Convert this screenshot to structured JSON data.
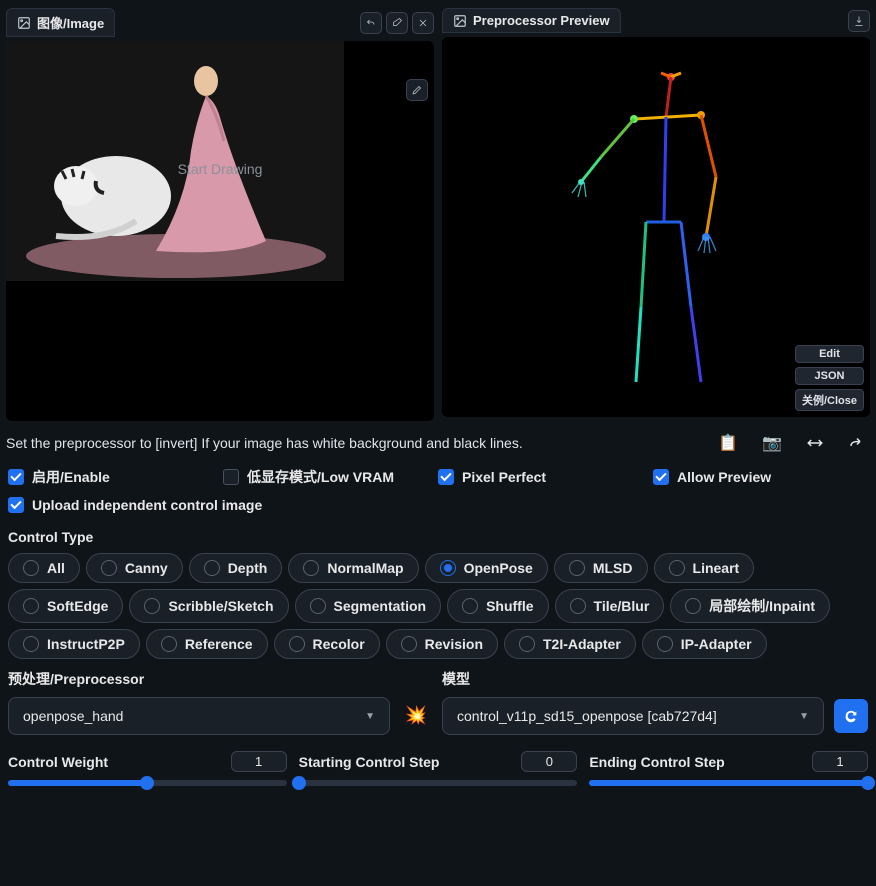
{
  "image_tab": "图像/Image",
  "preview_tab": "Preprocessor Preview",
  "draw_hint": "Start Drawing",
  "side_edit": "Edit",
  "side_json": "JSON",
  "side_close": "关例/Close",
  "hint": "Set the preprocessor to [invert] If your image has white background and black lines.",
  "cb_enable": "启用/Enable",
  "cb_lowvram": "低显存模式/Low VRAM",
  "cb_pixel": "Pixel Perfect",
  "cb_allow": "Allow Preview",
  "cb_upload": "Upload independent control image",
  "control_type_label": "Control Type",
  "types": [
    "All",
    "Canny",
    "Depth",
    "NormalMap",
    "OpenPose",
    "MLSD",
    "Lineart",
    "SoftEdge",
    "Scribble/Sketch",
    "Segmentation",
    "Shuffle",
    "Tile/Blur",
    "局部绘制/Inpaint",
    "InstructP2P",
    "Reference",
    "Recolor",
    "Revision",
    "T2I-Adapter",
    "IP-Adapter"
  ],
  "selected_type": "OpenPose",
  "preproc_label": "预处理/Preprocessor",
  "preproc_value": "openpose_hand",
  "model_label": "模型",
  "model_value": "control_v11p_sd15_openpose [cab727d4]",
  "s1_label": "Control Weight",
  "s1_val": "1",
  "s2_label": "Starting Control Step",
  "s2_val": "0",
  "s3_label": "Ending Control Step",
  "s3_val": "1"
}
